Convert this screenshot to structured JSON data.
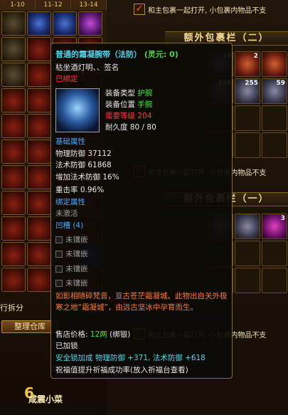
{
  "left_panel": {
    "tabs": [
      "1-10",
      "11-12",
      "13-14"
    ],
    "split_text": "行拆分",
    "organize_button": "整理仓库",
    "level_digit": "6",
    "character_name": "咸震小菜"
  },
  "right_panel": {
    "auto_open_notice": "和主包裹一起打开, 小包裹内物品不支",
    "extra_bag_2_title": "额外包裹栏（二）",
    "extra_bag_1_title": "额外包裹栏（一）",
    "bag2_counts": [
      "19",
      "2",
      "",
      "155",
      "255",
      "59"
    ],
    "bag1_counts": [
      "",
      "",
      "3"
    ]
  },
  "tooltip": {
    "title_name": "普通的霜凝腕带（法防）",
    "title_realm": "(灵元: 0)",
    "owner": "枯坐酒灯明、、签名",
    "bound_status": "已绑定",
    "equip_type_label": "装备类型",
    "equip_type_value": "护腕",
    "equip_slot_label": "装备位置",
    "equip_slot_value": "手腕",
    "required_level_label": "需要等级",
    "required_level_value": "204",
    "durability_label": "耐久度",
    "durability_value": "80 / 80",
    "base_attr_header": "基础属性",
    "phys_def": "物理防御 37112",
    "magic_def": "法术防御 61868",
    "magic_def_bonus": "增加法术防御 16%",
    "crit_rate": "重击率  0.96%",
    "bound_attr_header": "绑定属性",
    "not_activated": "未激活",
    "slots_header": "凹槽 (4)",
    "sockets": [
      "未镶嵌",
      "未镶嵌",
      "未镶嵌",
      "未镶嵌"
    ],
    "description": "如影相随碎梵音，亘古苍茫霜凝城。此物出自关外极寒之地“霜凝城”，由远古坚冰中孕育而生。",
    "price_label": "售店价格: ",
    "price_value": "12两",
    "price_note": "(绑银)",
    "locked": "已加锁",
    "safety_lock_bonus": "安全锁加成  物理防御 +371, 法术防御 +618",
    "blessing_line": "祝福值提升祈福成功率(放入祈福台查看)"
  }
}
